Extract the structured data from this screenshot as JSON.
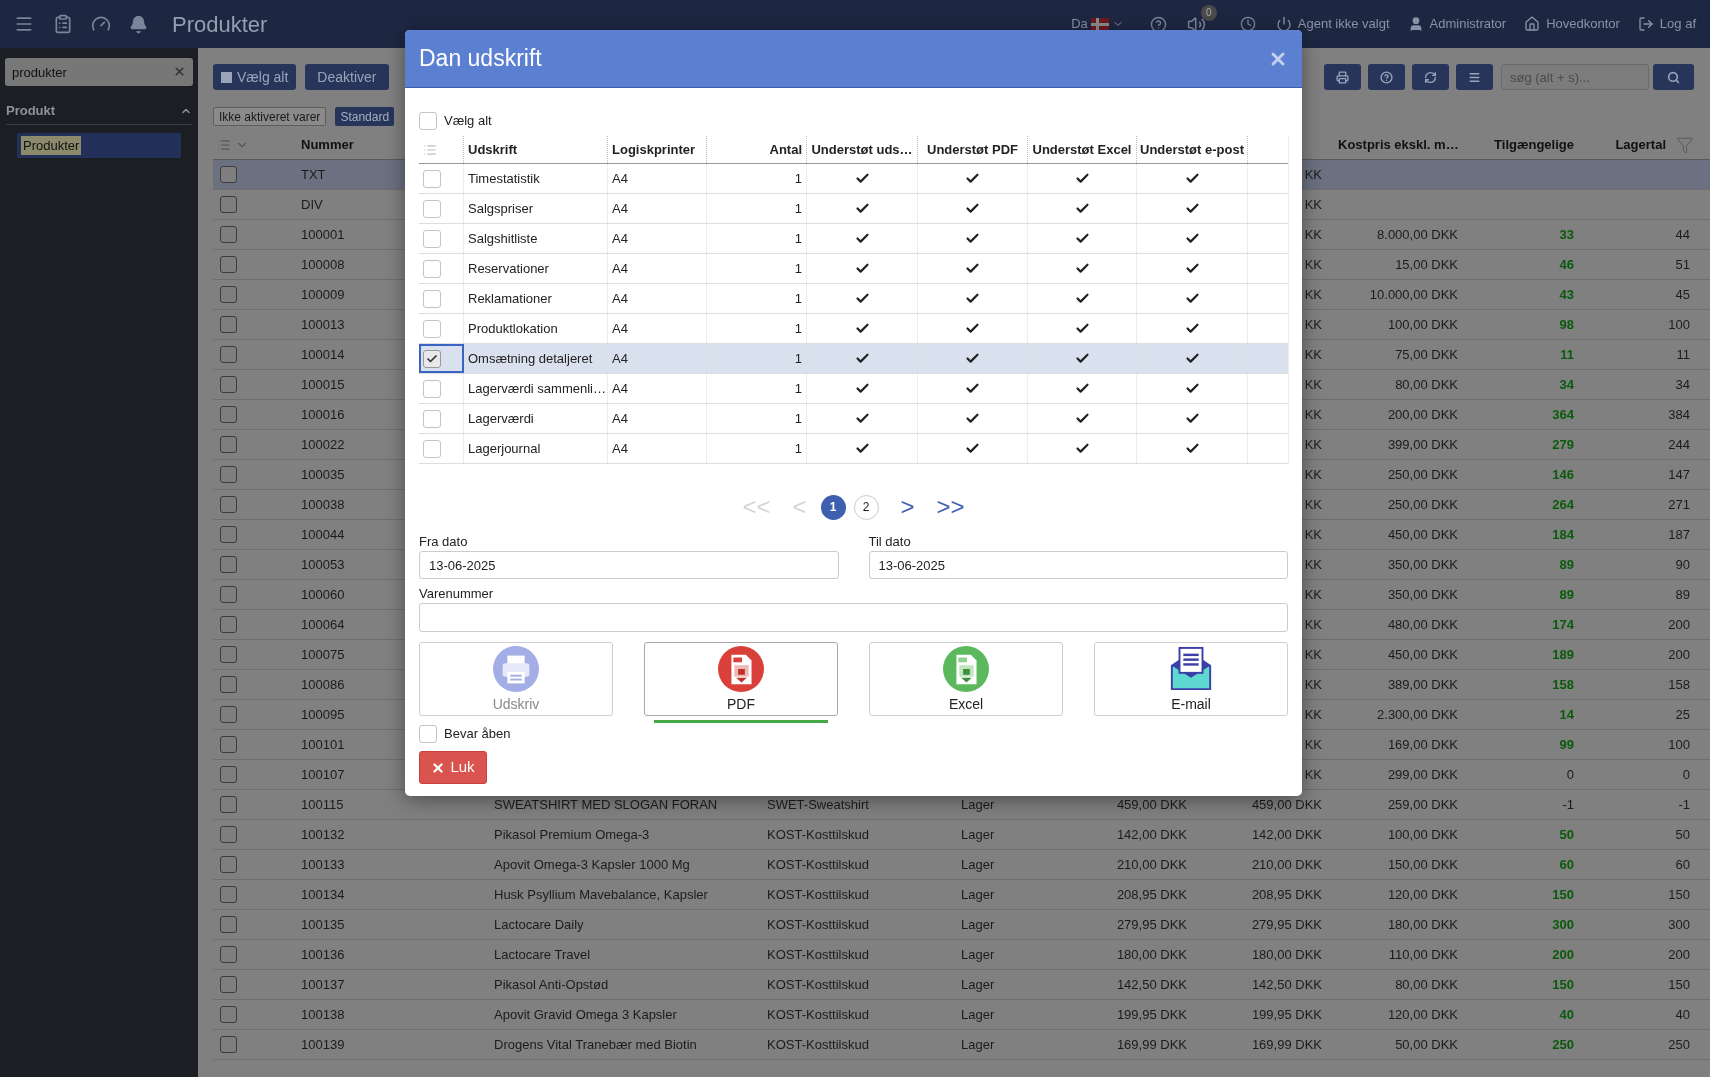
{
  "topbar": {
    "title": "Produkter",
    "language": "Da",
    "notification_count": "0",
    "agent": "Agent ikke valgt",
    "user": "Administrator",
    "location": "Hovedkontor",
    "logout": "Log af"
  },
  "sidebar": {
    "search": {
      "value": "produkter"
    },
    "section": {
      "label": "Produkt",
      "expanded": true
    },
    "items": [
      {
        "label": "Produkter",
        "selected": true
      }
    ]
  },
  "toolbar": {
    "buttons": [
      "Vælg alt",
      "Deaktiver"
    ],
    "search": {
      "placeholder": "søg (alt + s)..."
    }
  },
  "filters": [
    {
      "label": "Ikke aktiveret varer",
      "selected": false
    },
    {
      "label": "Standard",
      "selected": true
    }
  ],
  "table": {
    "header": {
      "number": "Nummer",
      "cost": "Kostpris ekskl. m…",
      "available": "Tilgængelige",
      "stock": "Lagertal"
    },
    "rows": [
      {
        "number": "TXT",
        "column_7": "KK",
        "selected": true,
        "checked": false
      },
      {
        "number": "DIV",
        "column_7": "KK",
        "selected": false,
        "checked": false
      },
      {
        "number": "100001",
        "column_7": "KK",
        "cost": "8.000,00 DKK",
        "available": "33",
        "available_highlight": true,
        "stock": "44",
        "selected": false,
        "checked": false
      },
      {
        "number": "100008",
        "column_7": "KK",
        "cost": "15,00 DKK",
        "available": "46",
        "available_highlight": true,
        "stock": "51",
        "selected": false,
        "checked": false
      },
      {
        "number": "100009",
        "column_7": "KK",
        "cost": "10.000,00 DKK",
        "available": "43",
        "available_highlight": true,
        "stock": "45",
        "selected": false,
        "checked": false
      },
      {
        "number": "100013",
        "column_7": "KK",
        "cost": "100,00 DKK",
        "available": "98",
        "available_highlight": true,
        "stock": "100",
        "selected": false,
        "checked": false
      },
      {
        "number": "100014",
        "column_7": "KK",
        "cost": "75,00 DKK",
        "available": "11",
        "available_highlight": true,
        "stock": "11",
        "selected": false,
        "checked": false
      },
      {
        "number": "100015",
        "column_7": "KK",
        "cost": "80,00 DKK",
        "available": "34",
        "available_highlight": true,
        "stock": "34",
        "selected": false,
        "checked": false
      },
      {
        "number": "100016",
        "column_7": "KK",
        "cost": "200,00 DKK",
        "available": "364",
        "available_highlight": true,
        "stock": "384",
        "selected": false,
        "checked": false
      },
      {
        "number": "100022",
        "column_7": "KK",
        "cost": "399,00 DKK",
        "available": "279",
        "available_highlight": true,
        "stock": "244",
        "selected": false,
        "checked": false
      },
      {
        "number": "100035",
        "column_7": "KK",
        "cost": "250,00 DKK",
        "available": "146",
        "available_highlight": true,
        "stock": "147",
        "selected": false,
        "checked": false
      },
      {
        "number": "100038",
        "column_7": "KK",
        "cost": "250,00 DKK",
        "available": "264",
        "available_highlight": true,
        "stock": "271",
        "selected": false,
        "checked": false
      },
      {
        "number": "100044",
        "column_7": "KK",
        "cost": "450,00 DKK",
        "available": "184",
        "available_highlight": true,
        "stock": "187",
        "selected": false,
        "checked": false
      },
      {
        "number": "100053",
        "column_7": "KK",
        "cost": "350,00 DKK",
        "available": "89",
        "available_highlight": true,
        "stock": "90",
        "selected": false,
        "checked": false
      },
      {
        "number": "100060",
        "column_7": "KK",
        "cost": "350,00 DKK",
        "available": "89",
        "available_highlight": true,
        "stock": "89",
        "selected": false,
        "checked": false
      },
      {
        "number": "100064",
        "column_7": "KK",
        "cost": "480,00 DKK",
        "available": "174",
        "available_highlight": true,
        "stock": "200",
        "selected": false,
        "checked": false
      },
      {
        "number": "100075",
        "column_7": "KK",
        "cost": "450,00 DKK",
        "available": "189",
        "available_highlight": true,
        "stock": "200",
        "selected": false,
        "checked": false
      },
      {
        "number": "100086",
        "column_7": "KK",
        "cost": "389,00 DKK",
        "available": "158",
        "available_highlight": true,
        "stock": "158",
        "selected": false,
        "checked": false
      },
      {
        "number": "100095",
        "column_7": "KK",
        "cost": "2.300,00 DKK",
        "available": "14",
        "available_highlight": true,
        "stock": "25",
        "selected": false,
        "checked": false
      },
      {
        "number": "100101",
        "column_7": "KK",
        "cost": "169,00 DKK",
        "available": "99",
        "available_highlight": true,
        "stock": "100",
        "selected": false,
        "checked": false
      },
      {
        "number": "100107",
        "column_7": "KK",
        "cost": "299,00 DKK",
        "available": "0",
        "available_highlight": false,
        "stock": "0",
        "selected": false,
        "checked": false
      },
      {
        "number": "100115",
        "column_3": "SWEATSHIRT MED SLOGAN FORAN",
        "column_4": "SWET-Sweatshirt",
        "column_5": "Lager",
        "column_6": "459,00 DKK",
        "column_7": "459,00 DKK",
        "cost": "259,00 DKK",
        "available": "-1",
        "available_highlight": false,
        "stock": "-1",
        "selected": false,
        "checked": false
      },
      {
        "number": "100132",
        "column_3": "Pikasol Premium Omega-3",
        "column_4": "KOST-Kosttilskud",
        "column_5": "Lager",
        "column_6": "142,00 DKK",
        "column_7": "142,00 DKK",
        "cost": "100,00 DKK",
        "available": "50",
        "available_highlight": true,
        "stock": "50",
        "selected": false,
        "checked": false
      },
      {
        "number": "100133",
        "column_3": "Apovit Omega-3 Kapsler 1000 Mg",
        "column_4": "KOST-Kosttilskud",
        "column_5": "Lager",
        "column_6": "210,00 DKK",
        "column_7": "210,00 DKK",
        "cost": "150,00 DKK",
        "available": "60",
        "available_highlight": true,
        "stock": "60",
        "selected": false,
        "checked": false
      },
      {
        "number": "100134",
        "column_3": "Husk Psyllium Mavebalance, Kapsler",
        "column_4": "KOST-Kosttilskud",
        "column_5": "Lager",
        "column_6": "208,95 DKK",
        "column_7": "208,95 DKK",
        "cost": "120,00 DKK",
        "available": "150",
        "available_highlight": true,
        "stock": "150",
        "selected": false,
        "checked": false
      },
      {
        "number": "100135",
        "column_3": "Lactocare Daily",
        "column_4": "KOST-Kosttilskud",
        "column_5": "Lager",
        "column_6": "279,95 DKK",
        "column_7": "279,95 DKK",
        "cost": "180,00 DKK",
        "available": "300",
        "available_highlight": true,
        "stock": "300",
        "selected": false,
        "checked": false
      },
      {
        "number": "100136",
        "column_3": "Lactocare Travel",
        "column_4": "KOST-Kosttilskud",
        "column_5": "Lager",
        "column_6": "180,00 DKK",
        "column_7": "180,00 DKK",
        "cost": "110,00 DKK",
        "available": "200",
        "available_highlight": true,
        "stock": "200",
        "selected": false,
        "checked": false
      },
      {
        "number": "100137",
        "column_3": "Pikasol Anti-Opstød",
        "column_4": "KOST-Kosttilskud",
        "column_5": "Lager",
        "column_6": "142,50 DKK",
        "column_7": "142,50 DKK",
        "cost": "80,00 DKK",
        "available": "150",
        "available_highlight": true,
        "stock": "150",
        "selected": false,
        "checked": false
      },
      {
        "number": "100138",
        "column_3": "Apovit Gravid Omega 3 Kapsler",
        "column_4": "KOST-Kosttilskud",
        "column_5": "Lager",
        "column_6": "199,95 DKK",
        "column_7": "199,95 DKK",
        "cost": "120,00 DKK",
        "available": "40",
        "available_highlight": true,
        "stock": "40",
        "selected": false,
        "checked": false
      },
      {
        "number": "100139",
        "column_3": "Drogens Vital Tranebær med Biotin",
        "column_4": "KOST-Kosttilskud",
        "column_5": "Lager",
        "column_6": "169,99 DKK",
        "column_7": "169,99 DKK",
        "cost": "50,00 DKK",
        "available": "250",
        "available_highlight": true,
        "stock": "250",
        "selected": false,
        "checked": false
      }
    ]
  },
  "dialog": {
    "title": "Dan udskrift",
    "select_all": {
      "label": "Vælg alt",
      "checked": false
    },
    "columns": [
      "Udskrift",
      "Logiskprinter",
      "Antal",
      "Understøt uds…",
      "Understøt PDF",
      "Understøt Excel",
      "Understøt e-post"
    ],
    "rows": [
      {
        "name": "Timestatistik",
        "printer": "A4",
        "count": "1",
        "print": true,
        "pdf": true,
        "excel": true,
        "email": true,
        "checked": false,
        "selected": false
      },
      {
        "name": "Salgspriser",
        "printer": "A4",
        "count": "1",
        "print": true,
        "pdf": true,
        "excel": true,
        "email": true,
        "checked": false,
        "selected": false
      },
      {
        "name": "Salgshitliste",
        "printer": "A4",
        "count": "1",
        "print": true,
        "pdf": true,
        "excel": true,
        "email": true,
        "checked": false,
        "selected": false
      },
      {
        "name": "Reservationer",
        "printer": "A4",
        "count": "1",
        "print": true,
        "pdf": true,
        "excel": true,
        "email": true,
        "checked": false,
        "selected": false
      },
      {
        "name": "Reklamationer",
        "printer": "A4",
        "count": "1",
        "print": true,
        "pdf": true,
        "excel": true,
        "email": true,
        "checked": false,
        "selected": false
      },
      {
        "name": "Produktlokation",
        "printer": "A4",
        "count": "1",
        "print": true,
        "pdf": true,
        "excel": true,
        "email": true,
        "checked": false,
        "selected": false
      },
      {
        "name": "Omsætning detaljeret",
        "printer": "A4",
        "count": "1",
        "print": true,
        "pdf": true,
        "excel": true,
        "email": true,
        "checked": true,
        "selected": true
      },
      {
        "name": "Lagerværdi sammenli…",
        "printer": "A4",
        "count": "1",
        "print": true,
        "pdf": true,
        "excel": true,
        "email": true,
        "checked": false,
        "selected": false
      },
      {
        "name": "Lagerværdi",
        "printer": "A4",
        "count": "1",
        "print": true,
        "pdf": true,
        "excel": true,
        "email": true,
        "checked": false,
        "selected": false
      },
      {
        "name": "Lagerjournal",
        "printer": "A4",
        "count": "1",
        "print": true,
        "pdf": true,
        "excel": true,
        "email": true,
        "checked": false,
        "selected": false
      }
    ],
    "pagination": {
      "first": "<<",
      "previous": "<",
      "previous_disabled": true,
      "pages": [
        {
          "label": "1",
          "selected": true
        },
        {
          "label": "2",
          "selected": false
        }
      ],
      "next": ">",
      "last": ">>",
      "next_disabled": false
    },
    "from_date": {
      "label": "Fra dato",
      "value": "13-06-2025"
    },
    "to_date": {
      "label": "Til dato",
      "value": "13-06-2025"
    },
    "item_number": {
      "label": "Varenummer"
    },
    "export_buttons": [
      {
        "label": "Udskriv",
        "kind": "print",
        "disabled": true,
        "selected": false
      },
      {
        "label": "PDF",
        "kind": "pdf",
        "disabled": false,
        "selected": true
      },
      {
        "label": "Excel",
        "kind": "excel",
        "disabled": false,
        "selected": false
      },
      {
        "label": "E-mail",
        "kind": "email",
        "disabled": false,
        "selected": false
      }
    ],
    "keep_open": {
      "label": "Bevar åben",
      "checked": false
    },
    "close": "Luk"
  }
}
